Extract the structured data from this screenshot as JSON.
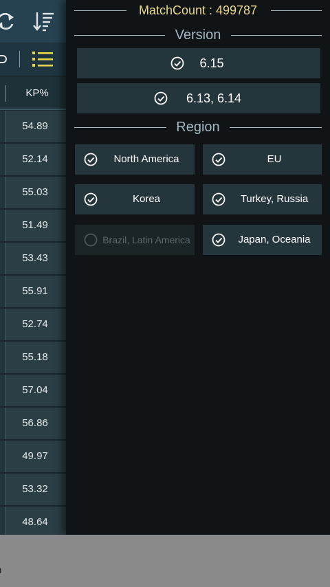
{
  "left_panel": {
    "kp_header": "KP%",
    "kp_values": [
      "54.89",
      "52.14",
      "55.03",
      "51.49",
      "53.43",
      "55.91",
      "52.74",
      "55.18",
      "57.04",
      "56.86",
      "49.97",
      "53.32",
      "48.64"
    ],
    "icons": {
      "refresh": "refresh-icon",
      "sort": "sort-icon",
      "list": "list-view-icon"
    }
  },
  "filter": {
    "match_count": "MatchCount : 499787",
    "version_heading": "Version",
    "versions": [
      {
        "label": "6.15",
        "checked": true
      },
      {
        "label": "6.13, 6.14",
        "checked": true
      }
    ],
    "region_heading": "Region",
    "regions": [
      {
        "label": "North America",
        "checked": true,
        "enabled": true
      },
      {
        "label": "EU",
        "checked": true,
        "enabled": true
      },
      {
        "label": "Korea",
        "checked": true,
        "enabled": true
      },
      {
        "label": "Turkey, Russia",
        "checked": true,
        "enabled": true
      },
      {
        "label": "Brazil, Latin America",
        "checked": false,
        "enabled": false
      },
      {
        "label": "Japan, Oceania",
        "checked": true,
        "enabled": true
      }
    ]
  },
  "bottom_bar": {
    "partial_text": "n"
  },
  "colors": {
    "accent_gold": "#e9d88a",
    "heading_blue": "#a3b9c3",
    "list_icon_yellow": "#e6d84a",
    "option_bg": "#25353c"
  }
}
